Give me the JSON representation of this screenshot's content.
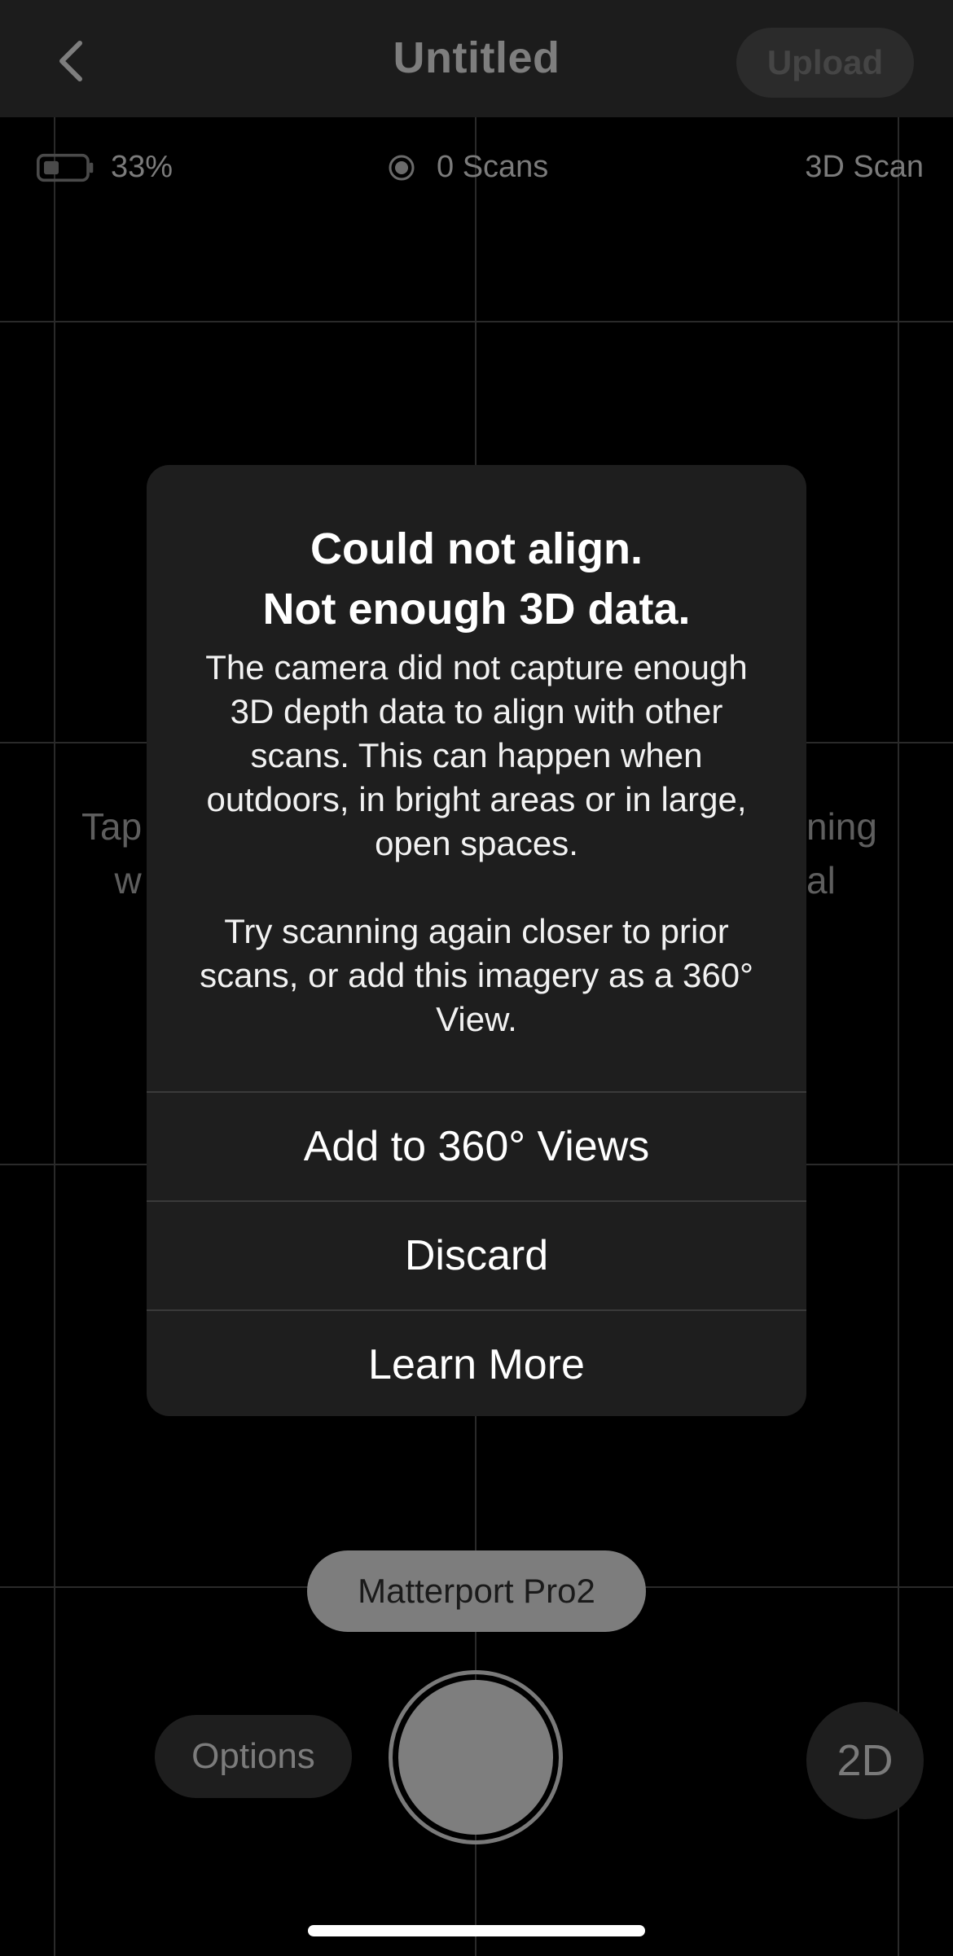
{
  "header": {
    "back_icon": "chevron-left-icon",
    "title": "Untitled",
    "upload_label": "Upload"
  },
  "status": {
    "battery_icon": "battery-icon",
    "battery_text": "33%",
    "scans_icon": "record-dot-icon",
    "scans_text": "0 Scans",
    "mode_text": "3D Scan"
  },
  "background_hint": {
    "left_line1": "Tap",
    "left_line2": "w",
    "right_line1": "ning",
    "right_line2": "al"
  },
  "alert": {
    "title_line1": "Could not align.",
    "title_line2": "Not enough 3D data.",
    "message_line1": "The camera did not capture enough 3D depth data to align with other scans. This can happen when outdoors, in bright areas or in large, open spaces.",
    "message_line2": "Try scanning again closer to prior scans, or add this imagery as a 360° View.",
    "actions": [
      {
        "label": "Add to 360° Views"
      },
      {
        "label": "Discard"
      },
      {
        "label": "Learn More"
      }
    ]
  },
  "controls": {
    "device_label": "Matterport Pro2",
    "options_label": "Options",
    "mode_2d_label": "2D",
    "shutter_icon": "shutter-icon"
  },
  "colors": {
    "background": "#000000",
    "header": "#1c1c1c",
    "dialog": "#1e1e1e",
    "muted_text": "#7b7b7b"
  }
}
